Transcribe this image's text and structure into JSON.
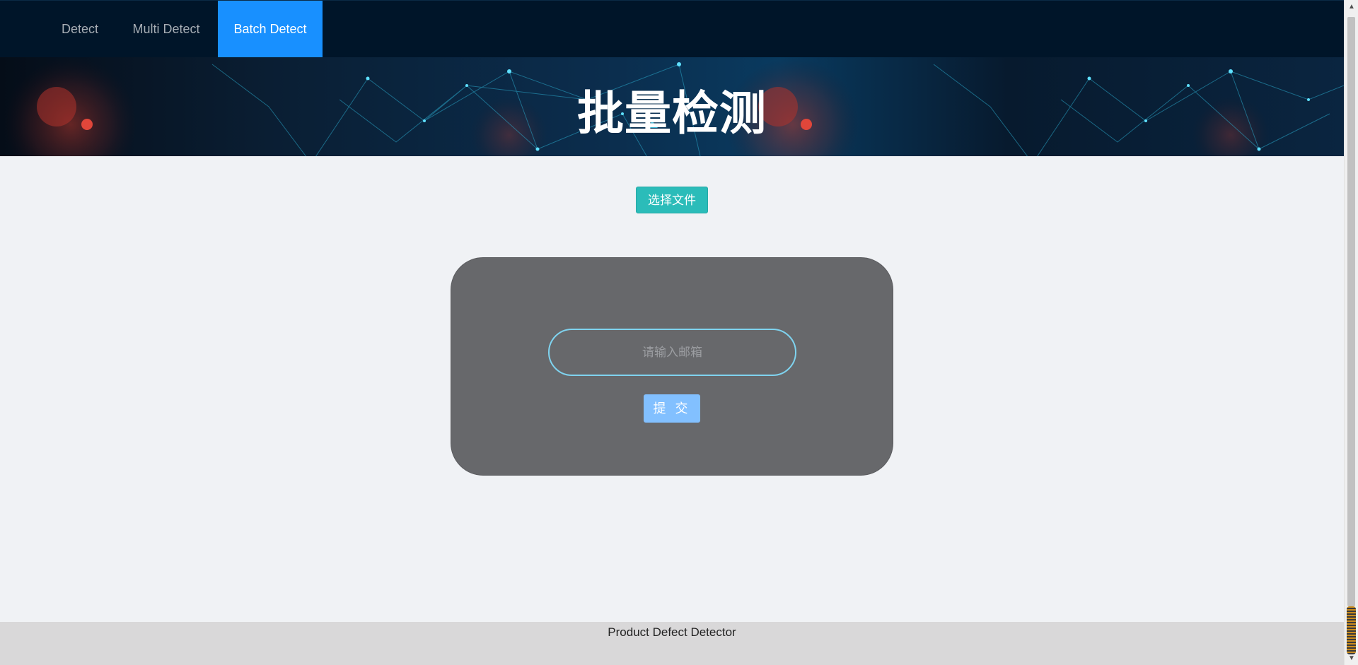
{
  "nav": {
    "items": [
      {
        "label": "Detect",
        "active": false
      },
      {
        "label": "Multi Detect",
        "active": false
      },
      {
        "label": "Batch Detect",
        "active": true
      }
    ],
    "background": "#001529",
    "active_color": "#1890ff"
  },
  "banner": {
    "title": "批量检测"
  },
  "upload": {
    "choose_file_label": "选择文件",
    "color": "#2bbcb9"
  },
  "form": {
    "email_placeholder": "请输入邮箱",
    "email_value": "",
    "submit_label": "提 交",
    "card_color": "#67686b",
    "input_border_color": "#7fd3ef",
    "submit_color": "#82c0ff"
  },
  "footer": {
    "text": "Product Defect Detector"
  },
  "icons": {
    "scroll_up": "chevron-up-icon",
    "scroll_down": "chevron-down-icon"
  }
}
